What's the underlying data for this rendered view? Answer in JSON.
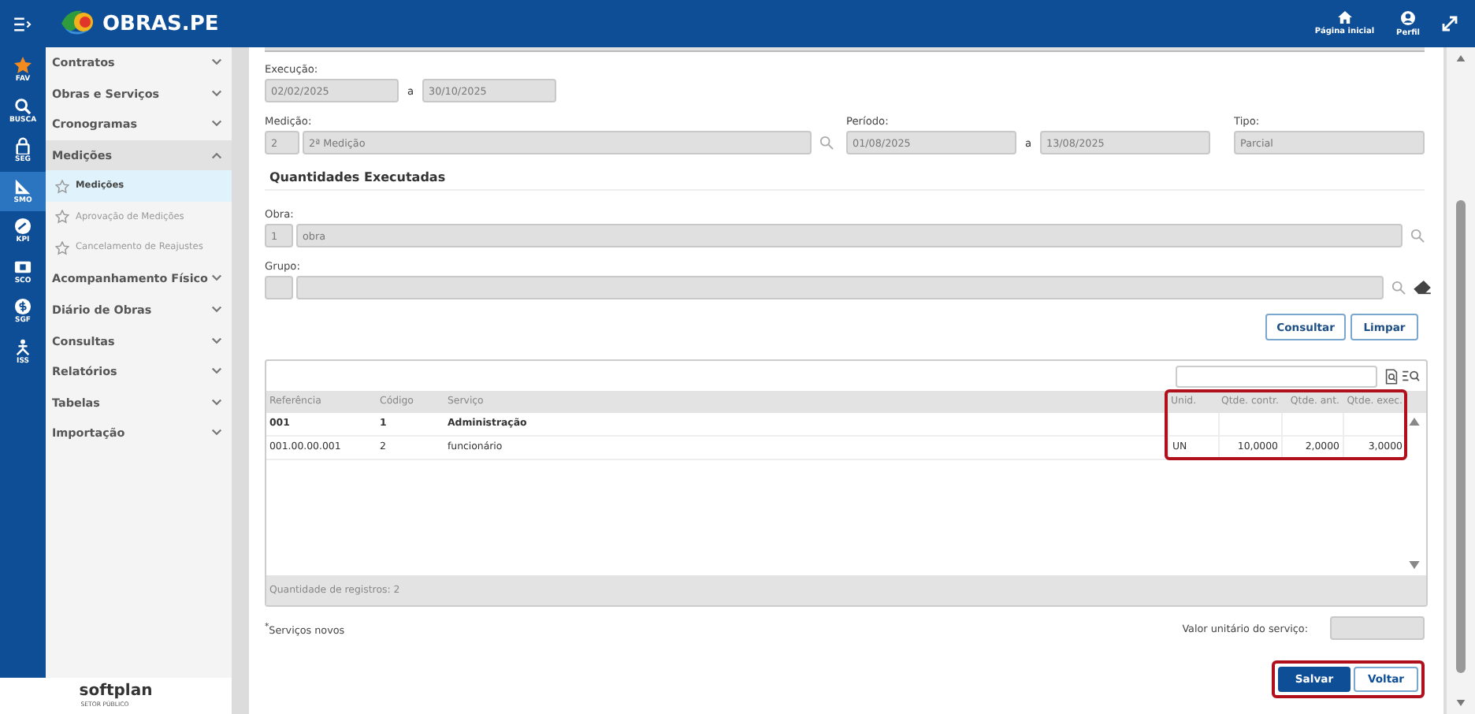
{
  "header": {
    "title": "OBRAS.PE",
    "actions": [
      {
        "kind": "home",
        "label": "Página inicial"
      },
      {
        "kind": "profile",
        "label": "Perfil"
      }
    ]
  },
  "rail": [
    {
      "kind": "star",
      "label": "FAV",
      "selected": false
    },
    {
      "kind": "search",
      "label": "BUSCA",
      "selected": false
    },
    {
      "kind": "lock",
      "label": "SEG",
      "selected": false
    },
    {
      "kind": "ruler",
      "label": "SMO",
      "selected": true
    },
    {
      "kind": "gauge",
      "label": "KPI",
      "selected": false
    },
    {
      "kind": "money",
      "label": "SCO",
      "selected": false
    },
    {
      "kind": "coin",
      "label": "SGF",
      "selected": false
    },
    {
      "kind": "person",
      "label": "ISS",
      "selected": false
    }
  ],
  "sidebar": {
    "items": [
      {
        "label": "Contratos",
        "expanded": false
      },
      {
        "label": "Obras e Serviços",
        "expanded": false
      },
      {
        "label": "Cronogramas",
        "expanded": false
      },
      {
        "label": "Medições",
        "expanded": true,
        "children": [
          {
            "label": "Medições",
            "selected": true
          },
          {
            "label": "Aprovação de Medições",
            "selected": false
          },
          {
            "label": "Cancelamento de Reajustes",
            "selected": false
          }
        ]
      },
      {
        "label": "Acompanhamento Físico",
        "expanded": false
      },
      {
        "label": "Diário de Obras",
        "expanded": false
      },
      {
        "label": "Consultas",
        "expanded": false
      },
      {
        "label": "Relatórios",
        "expanded": false
      },
      {
        "label": "Tabelas",
        "expanded": false
      },
      {
        "label": "Importação",
        "expanded": false
      }
    ],
    "footer": {
      "brand": "softplan",
      "subtitle": "SETOR PÚBLICO"
    }
  },
  "form": {
    "execucao": {
      "label": "Execução:",
      "from": "02/02/2025",
      "separator": "a",
      "to": "30/10/2025"
    },
    "medicao": {
      "label": "Medição:",
      "code": "2",
      "name": "2ª Medição"
    },
    "periodo": {
      "label": "Período:",
      "from": "01/08/2025",
      "separator": "a",
      "to": "13/08/2025"
    },
    "tipo": {
      "label": "Tipo:",
      "value": "Parcial"
    },
    "section": "Quantidades Executadas",
    "obra": {
      "label": "Obra:",
      "code": "1",
      "name": "obra"
    },
    "grupo": {
      "label": "Grupo:"
    },
    "buttons": [
      "Consultar",
      "Limpar"
    ]
  },
  "table": {
    "columns": [
      {
        "label": "Referência",
        "highlighted": false
      },
      {
        "label": "Código",
        "highlighted": false
      },
      {
        "label": "Serviço",
        "highlighted": false
      },
      {
        "label": "Unid.",
        "highlighted": true
      },
      {
        "label": "Qtde. contr.",
        "highlighted": true
      },
      {
        "label": "Qtde. ant.",
        "highlighted": true
      },
      {
        "label": "Qtde. exec.",
        "highlighted": true
      }
    ],
    "rows": [
      {
        "kind": "group",
        "cells": [
          "001",
          "1",
          "Administração",
          "",
          "",
          "",
          ""
        ]
      },
      {
        "kind": "item",
        "cells": [
          "001.00.00.001",
          "2",
          "funcionário",
          "UN",
          "10,0000",
          "2,0000",
          "3,0000"
        ]
      }
    ],
    "footer": "Quantidade de registros: 2"
  },
  "note": "$^{*}$Serviços novos",
  "valor": {
    "label": "Valor unitário do serviço:"
  },
  "actions": {
    "highlighted": true,
    "buttons": [
      {
        "kind": "primary",
        "label": "Salvar"
      },
      {
        "kind": "secondary",
        "label": "Voltar"
      }
    ]
  }
}
